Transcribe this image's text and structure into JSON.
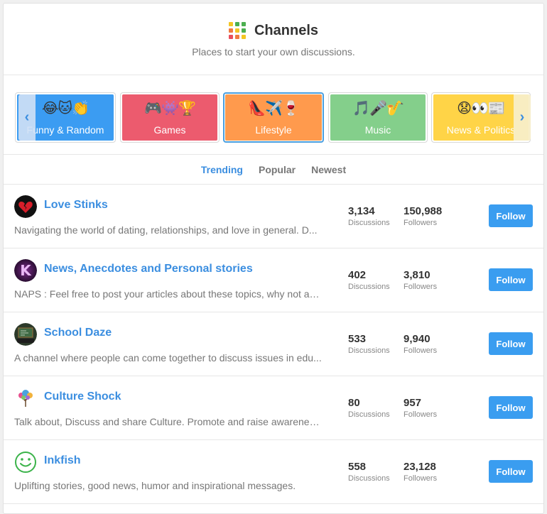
{
  "header": {
    "title": "Channels",
    "subtitle": "Places to start your own discussions.",
    "icon": "grid-icon",
    "grid_colors": [
      "#f3c623",
      "#4caf50",
      "#4caf50",
      "#f07b3f",
      "#f3c623",
      "#4caf50",
      "#e94e5c",
      "#f07b3f",
      "#f3c623"
    ]
  },
  "categories": [
    {
      "label": "Funny & Random",
      "emojis": "😂🐱👏",
      "color": "#3b9cf2",
      "active": false
    },
    {
      "label": "Games",
      "emojis": "🎮👾🏆",
      "color": "#ec5b6e",
      "active": false
    },
    {
      "label": "Lifestyle",
      "emojis": "👠✈️🍷",
      "color": "#ff9a4d",
      "active": true
    },
    {
      "label": "Music",
      "emojis": "🎵🎤🎷",
      "color": "#84cf8b",
      "active": false
    },
    {
      "label": "News & Politics",
      "emojis": "😧👀📰",
      "color": "#ffd447",
      "active": false
    }
  ],
  "carousel": {
    "prev_icon": "chevron-left-icon",
    "next_icon": "chevron-right-icon",
    "prev_glyph": "‹",
    "next_glyph": "›"
  },
  "tabs": [
    {
      "label": "Trending",
      "active": true
    },
    {
      "label": "Popular",
      "active": false
    },
    {
      "label": "Newest",
      "active": false
    }
  ],
  "channels": [
    {
      "name": "Love Stinks",
      "description": "Navigating the world of dating, relationships, and love in general. D...",
      "discussions": "3,134",
      "followers": "150,988",
      "discussions_label": "Discussions",
      "followers_label": "Followers",
      "button": "Follow",
      "avatar": "broken-heart-icon"
    },
    {
      "name": "News, Anecdotes and Personal stories",
      "description": "NAPS : Feel free to post your articles about these topics, why not ab...",
      "discussions": "402",
      "followers": "3,810",
      "discussions_label": "Discussions",
      "followers_label": "Followers",
      "button": "Follow",
      "avatar": "letter-k-icon"
    },
    {
      "name": "School Daze",
      "description": "A channel where people can come together to discuss issues in edu...",
      "discussions": "533",
      "followers": "9,940",
      "discussions_label": "Discussions",
      "followers_label": "Followers",
      "button": "Follow",
      "avatar": "chalkboard-icon"
    },
    {
      "name": "Culture Shock",
      "description": "Talk about, Discuss and share Culture. Promote and raise awarenes...",
      "discussions": "80",
      "followers": "957",
      "discussions_label": "Discussions",
      "followers_label": "Followers",
      "button": "Follow",
      "avatar": "tree-icon"
    },
    {
      "name": "Inkfish",
      "description": "Uplifting stories, good news, humor and inspirational messages.",
      "discussions": "558",
      "followers": "23,128",
      "discussions_label": "Discussions",
      "followers_label": "Followers",
      "button": "Follow",
      "avatar": "smiley-icon"
    }
  ]
}
